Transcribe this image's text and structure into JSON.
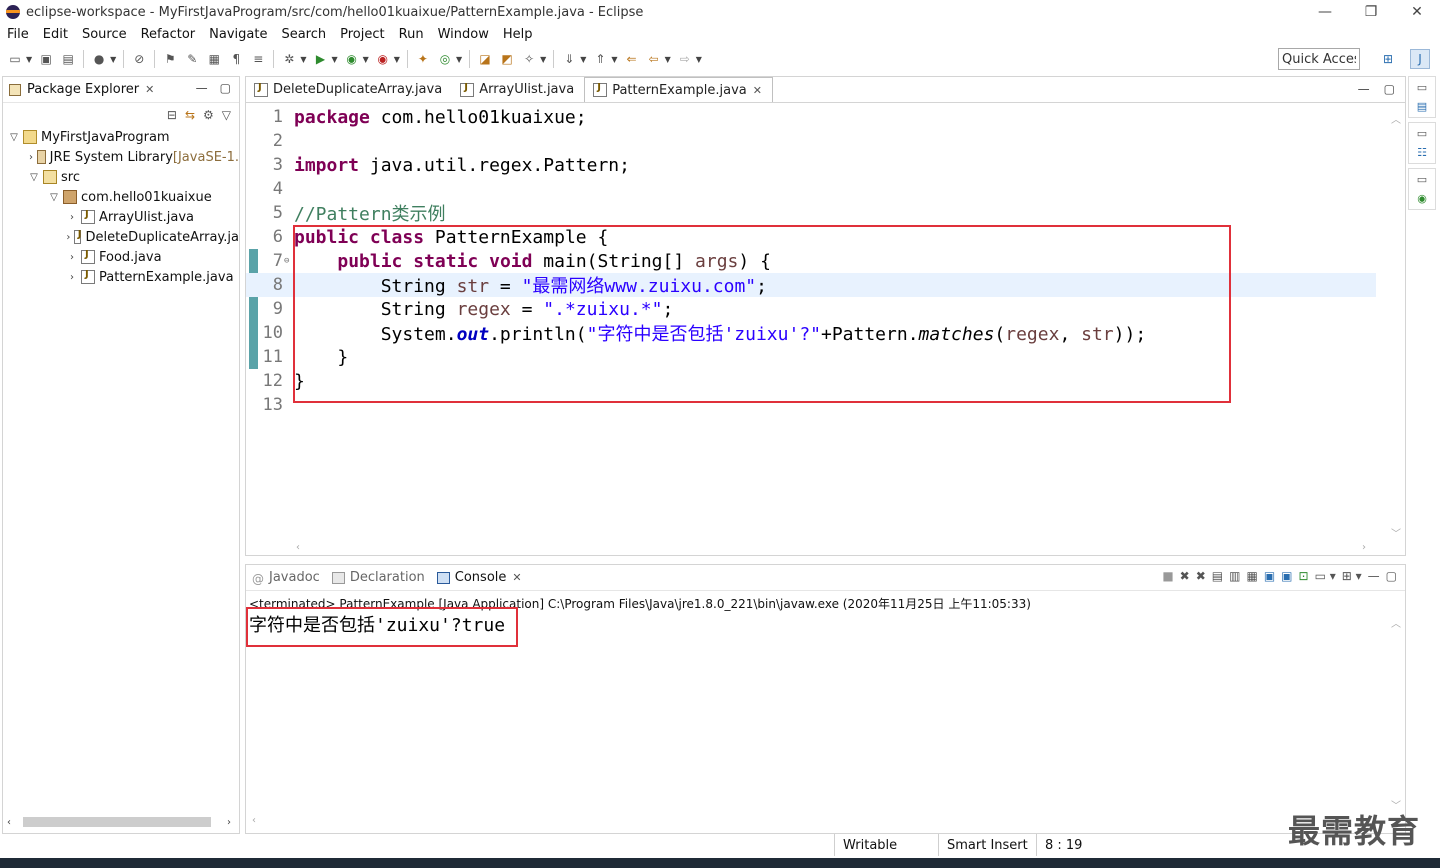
{
  "window": {
    "title": "eclipse-workspace - MyFirstJavaProgram/src/com/hello01kuaixue/PatternExample.java - Eclipse",
    "minimize": "—",
    "restore": "❐",
    "close": "✕"
  },
  "menu": [
    "File",
    "Edit",
    "Source",
    "Refactor",
    "Navigate",
    "Search",
    "Project",
    "Run",
    "Window",
    "Help"
  ],
  "quick_access": "Quick Access",
  "package_explorer": {
    "title": "Package Explorer",
    "tree": [
      {
        "label": "MyFirstJavaProgram",
        "suffix": "",
        "icon": "project-icon"
      },
      {
        "label": "JRE System Library ",
        "suffix": "[JavaSE-1.",
        "icon": "library-icon"
      },
      {
        "label": "src",
        "suffix": "",
        "icon": "source-folder-icon"
      },
      {
        "label": "com.hello01kuaixue",
        "suffix": "",
        "icon": "package-icon"
      },
      {
        "label": "ArrayUlist.java",
        "suffix": "",
        "icon": "java-file-icon"
      },
      {
        "label": "DeleteDuplicateArray.ja",
        "suffix": "",
        "icon": "java-file-icon"
      },
      {
        "label": "Food.java",
        "suffix": "",
        "icon": "java-file-icon"
      },
      {
        "label": "PatternExample.java",
        "suffix": "",
        "icon": "java-file-icon"
      }
    ]
  },
  "editor": {
    "tabs": [
      "DeleteDuplicateArray.java",
      "ArrayUlist.java",
      "PatternExample.java"
    ],
    "active_tab": "PatternExample.java",
    "line_numbers": [
      "1",
      "2",
      "3",
      "4",
      "5",
      "6",
      "7",
      "8",
      "9",
      "10",
      "11",
      "12",
      "13"
    ],
    "code": {
      "l1_kw": "package",
      "l1_rest": " com.hello01kuaixue;",
      "l3_kw": "import",
      "l3_rest": " java.util.regex.Pattern;",
      "l5_cmt": "//Pattern类示例",
      "l6_kw1": "public",
      "l6_kw2": "class",
      "l6_rest": " PatternExample {",
      "l7_indent": "    ",
      "l7_kw1": "public",
      "l7_kw2": "static",
      "l7_kw3": "void",
      "l7_a": " main(String[] ",
      "l7_var": "args",
      "l7_b": ") {",
      "l8_indent": "        ",
      "l8_a": "String ",
      "l8_var": "str",
      "l8_b": " = ",
      "l8_str": "\"最需网络www.zuixu.com\"",
      "l8_c": ";",
      "l9_indent": "        ",
      "l9_a": "String ",
      "l9_var": "regex",
      "l9_b": " = ",
      "l9_str": "\".*zuixu.*\"",
      "l9_c": ";",
      "l10_indent": "        ",
      "l10_a": "System.",
      "l10_fld": "out",
      "l10_b": ".println(",
      "l10_str": "\"字符中是否包括'zuixu'?\"",
      "l10_c": "+Pattern.",
      "l10_static": "matches",
      "l10_d": "(",
      "l10_var1": "regex",
      "l10_e": ", ",
      "l10_var2": "str",
      "l10_f": "));",
      "l11": "    }",
      "l12": "}"
    }
  },
  "console": {
    "tabs": [
      "Javadoc",
      "Declaration",
      "Console"
    ],
    "active_tab": "Console",
    "terminated": "<terminated> PatternExample [Java Application] C:\\Program Files\\Java\\jre1.8.0_221\\bin\\javaw.exe (2020年11月25日 上午11:05:33)",
    "output": "字符中是否包括'zuixu'?true"
  },
  "status": {
    "writable": "Writable",
    "insert_mode": "Smart Insert",
    "position": "8 : 19"
  },
  "watermark": "最需教育"
}
